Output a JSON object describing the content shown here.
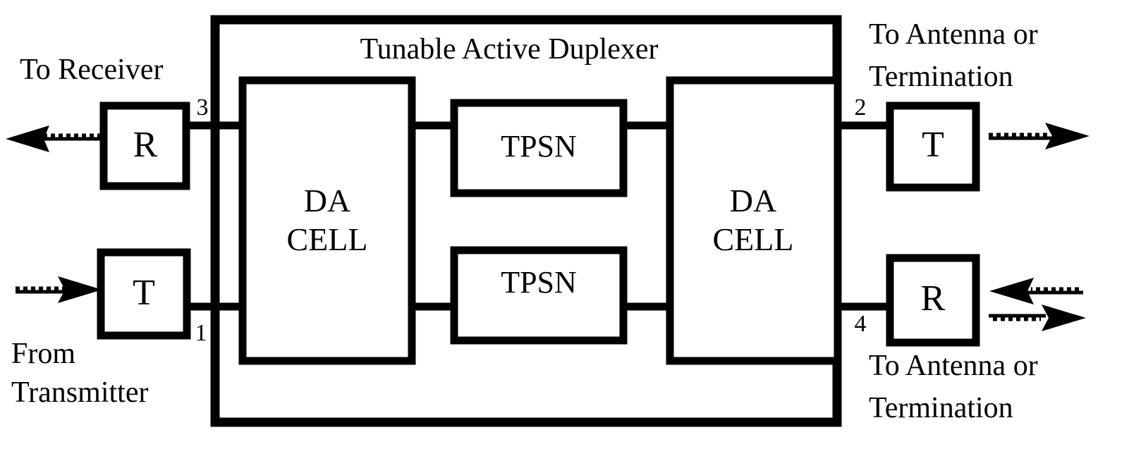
{
  "figure": {
    "title": "Tunable Active Duplexer",
    "type": "block-diagram"
  },
  "outer_block": {
    "label": "Tunable Active Duplexer"
  },
  "blocks": {
    "da_cell_left": {
      "line1": "DA",
      "line2": "CELL"
    },
    "da_cell_right": {
      "line1": "DA",
      "line2": "CELL"
    },
    "tpsn_top": {
      "label": "TPSN"
    },
    "tpsn_bottom": {
      "label": "TPSN"
    },
    "r_top_left": {
      "label": "R"
    },
    "t_bottom_left": {
      "label": "T"
    },
    "t_top_right": {
      "label": "T"
    },
    "r_bottom_right": {
      "label": "R"
    }
  },
  "ports": {
    "p1": "1",
    "p2": "2",
    "p3": "3",
    "p4": "4"
  },
  "captions": {
    "to_receiver": "To Receiver",
    "from_transmitter_line1": "From",
    "from_transmitter_line2": "Transmitter",
    "antenna_top_line1": "To Antenna or",
    "antenna_top_line2": "Termination",
    "antenna_bottom_line1": "To Antenna or",
    "antenna_bottom_line2": "Termination"
  },
  "colors": {
    "stroke": "#000000",
    "background": "#ffffff"
  }
}
